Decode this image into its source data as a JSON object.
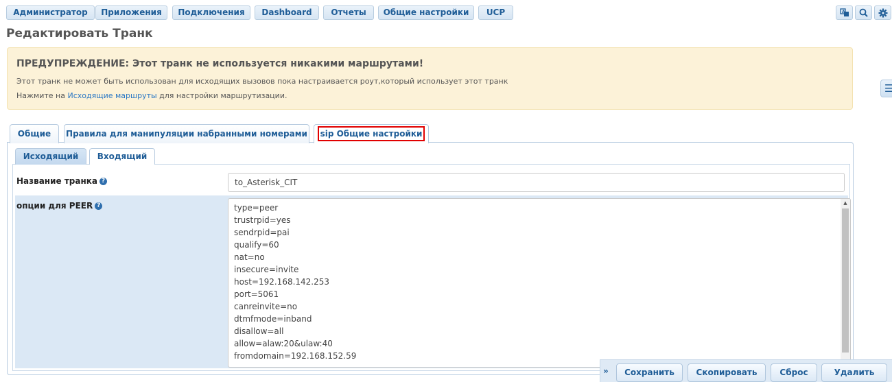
{
  "topnav": {
    "items": [
      {
        "label": "Администратор"
      },
      {
        "label": "Приложения"
      },
      {
        "label": "Подключения"
      },
      {
        "label": "Dashboard"
      },
      {
        "label": "Отчеты"
      },
      {
        "label": "Общие настройки"
      },
      {
        "label": "UCP"
      }
    ],
    "icons": [
      "language-icon",
      "search-icon",
      "gear-icon"
    ]
  },
  "page": {
    "title": "Редактировать Транк"
  },
  "warning": {
    "title": "ПРЕДУПРЕЖДЕНИЕ: Этот транк не используется никакими маршрутами!",
    "line1": "Этот транк не может быть использован для исходящих вызовов пока настраивается роут,который использует этот транк",
    "line2_prefix": "Нажмите на ",
    "line2_link": "Исходящие маршруты",
    "line2_suffix": " для настройки маршрутизации."
  },
  "tabs": [
    {
      "label": "Общие"
    },
    {
      "label": "Правила для манипуляции набранными номерами"
    },
    {
      "label": "sip Общие настройки",
      "active": true
    }
  ],
  "subtabs": [
    {
      "label": "Исходящий",
      "active": true
    },
    {
      "label": "Входящий"
    }
  ],
  "form": {
    "trunk_name_label": "Название транка",
    "trunk_name_value": "to_Asterisk_CIT",
    "peer_label": "опции для PEER",
    "peer_lines": [
      "type=peer",
      "trustrpid=yes",
      "sendrpid=pai",
      "qualify=60",
      "nat=no",
      "insecure=invite",
      "host=192.168.142.253",
      "port=5061",
      "canreinvite=no",
      "dtmfmode=inband",
      "disallow=all",
      "allow=alaw:20&ulaw:40",
      "fromdomain=192.168.152.59"
    ]
  },
  "actions": {
    "collapse": "»",
    "save": "Сохранить",
    "copy": "Скопировать",
    "reset": "Сброс",
    "delete": "Удалить"
  },
  "colors": {
    "accent": "#1f5d97",
    "warning_bg": "#fcf2d8",
    "highlight": "#e10000"
  }
}
